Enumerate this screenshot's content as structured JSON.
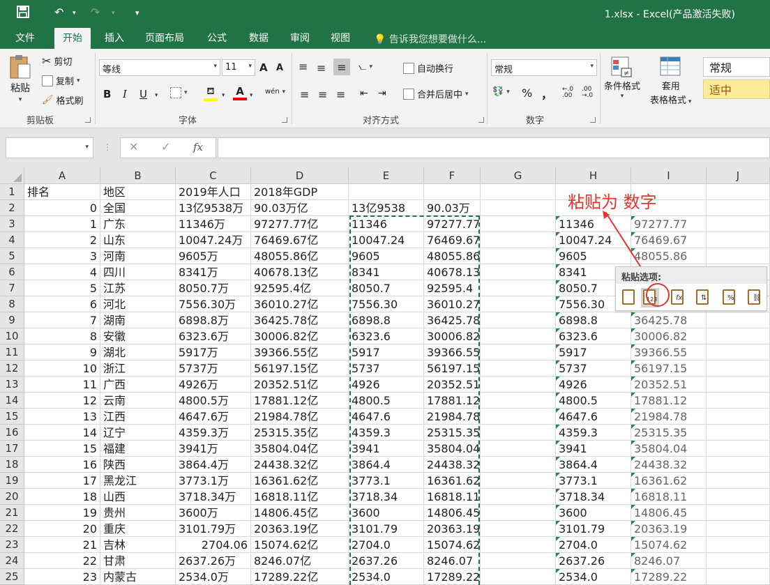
{
  "titlebar": {
    "title": "1.xlsx - Excel(产品激活失败)",
    "qa_dropdown": "▾"
  },
  "tabs": [
    "文件",
    "开始",
    "插入",
    "页面布局",
    "公式",
    "数据",
    "审阅",
    "视图"
  ],
  "tell_me": "告诉我您想要做什么...",
  "ribbon": {
    "clipboard": {
      "paste": "粘贴",
      "cut": "剪切",
      "copy": "复制",
      "format_painter": "格式刷",
      "label": "剪贴板"
    },
    "font": {
      "name": "等线",
      "size": "11",
      "label": "字体",
      "bold": "B",
      "italic": "I",
      "underline": "U",
      "grow": "A",
      "shrink": "A",
      "font_color": "A",
      "phonetic": "wén"
    },
    "alignment": {
      "wrap": "自动换行",
      "merge": "合并后居中",
      "label": "对齐方式"
    },
    "number": {
      "format": "常规",
      "label": "数字",
      "percent": "%",
      "comma": "，",
      "inc": "←.0\n.00",
      "dec": ".00\n→.0"
    },
    "styles": {
      "conditional": "条件格式",
      "table": "套用",
      "table2": "表格格式",
      "normal": "常规",
      "neutral": "适中"
    }
  },
  "formula": {
    "fx": "fx",
    "cancel": "✕",
    "enter": "✓"
  },
  "columns": [
    "A",
    "B",
    "C",
    "D",
    "E",
    "F",
    "G",
    "H",
    "I",
    "J"
  ],
  "rows": [
    {
      "n": "1",
      "A": "排名",
      "B": "地区",
      "C": "2019年人口",
      "D": "2018年GDP",
      "E": "",
      "F": "",
      "H": "",
      "I": ""
    },
    {
      "n": "2",
      "A": "0",
      "B": "全国",
      "C": "13亿9538万",
      "D": "90.03万亿",
      "E": "13亿9538",
      "F": "90.03万",
      "H": "",
      "I": ""
    },
    {
      "n": "3",
      "A": "1",
      "B": "广东",
      "C": "11346万",
      "D": "97277.77亿",
      "E": "11346",
      "F": "97277.77",
      "H": "11346",
      "I": "97277.77"
    },
    {
      "n": "4",
      "A": "2",
      "B": "山东",
      "C": "10047.24万",
      "D": "76469.67亿",
      "E": "10047.24",
      "F": "76469.67",
      "H": "10047.24",
      "I": "76469.67"
    },
    {
      "n": "5",
      "A": "3",
      "B": "河南",
      "C": "9605万",
      "D": "48055.86亿",
      "E": "9605",
      "F": "48055.86",
      "H": "9605",
      "I": "48055.86"
    },
    {
      "n": "6",
      "A": "4",
      "B": "四川",
      "C": "8341万",
      "D": "40678.13亿",
      "E": "8341",
      "F": "40678.13",
      "H": "8341",
      "I": ""
    },
    {
      "n": "7",
      "A": "5",
      "B": "江苏",
      "C": "8050.7万",
      "D": "92595.4亿",
      "E": "8050.7",
      "F": "92595.4",
      "H": "8050.7",
      "I": ""
    },
    {
      "n": "8",
      "A": "6",
      "B": "河北",
      "C": "7556.30万",
      "D": "36010.27亿",
      "E": "7556.30",
      "F": "36010.27",
      "H": "7556.30",
      "I": ""
    },
    {
      "n": "9",
      "A": "7",
      "B": "湖南",
      "C": "6898.8万",
      "D": "36425.78亿",
      "E": "6898.8",
      "F": "36425.78",
      "H": "6898.8",
      "I": "36425.78"
    },
    {
      "n": "10",
      "A": "8",
      "B": "安徽",
      "C": "6323.6万",
      "D": "30006.82亿",
      "E": "6323.6",
      "F": "30006.82",
      "H": "6323.6",
      "I": "30006.82"
    },
    {
      "n": "11",
      "A": "9",
      "B": "湖北",
      "C": "5917万",
      "D": "39366.55亿",
      "E": "5917",
      "F": "39366.55",
      "H": "5917",
      "I": "39366.55"
    },
    {
      "n": "12",
      "A": "10",
      "B": "浙江",
      "C": "5737万",
      "D": "56197.15亿",
      "E": "5737",
      "F": "56197.15",
      "H": "5737",
      "I": "56197.15"
    },
    {
      "n": "13",
      "A": "11",
      "B": "广西",
      "C": "4926万",
      "D": "20352.51亿",
      "E": "4926",
      "F": "20352.51",
      "H": "4926",
      "I": "20352.51"
    },
    {
      "n": "14",
      "A": "12",
      "B": "云南",
      "C": "4800.5万",
      "D": "17881.12亿",
      "E": "4800.5",
      "F": "17881.12",
      "H": "4800.5",
      "I": "17881.12"
    },
    {
      "n": "15",
      "A": "13",
      "B": "江西",
      "C": "4647.6万",
      "D": "21984.78亿",
      "E": "4647.6",
      "F": "21984.78",
      "H": "4647.6",
      "I": "21984.78"
    },
    {
      "n": "16",
      "A": "14",
      "B": "辽宁",
      "C": "4359.3万",
      "D": "25315.35亿",
      "E": "4359.3",
      "F": "25315.35",
      "H": "4359.3",
      "I": "25315.35"
    },
    {
      "n": "17",
      "A": "15",
      "B": "福建",
      "C": "3941万",
      "D": "35804.04亿",
      "E": "3941",
      "F": "35804.04",
      "H": "3941",
      "I": "35804.04"
    },
    {
      "n": "18",
      "A": "16",
      "B": "陕西",
      "C": "3864.4万",
      "D": "24438.32亿",
      "E": "3864.4",
      "F": "24438.32",
      "H": "3864.4",
      "I": "24438.32"
    },
    {
      "n": "19",
      "A": "17",
      "B": "黑龙江",
      "C": "3773.1万",
      "D": "16361.62亿",
      "E": "3773.1",
      "F": "16361.62",
      "H": "3773.1",
      "I": "16361.62"
    },
    {
      "n": "20",
      "A": "18",
      "B": "山西",
      "C": "3718.34万",
      "D": "16818.11亿",
      "E": "3718.34",
      "F": "16818.11",
      "H": "3718.34",
      "I": "16818.11"
    },
    {
      "n": "21",
      "A": "19",
      "B": "贵州",
      "C": "3600万",
      "D": "14806.45亿",
      "E": "3600",
      "F": "14806.45",
      "H": "3600",
      "I": "14806.45"
    },
    {
      "n": "22",
      "A": "20",
      "B": "重庆",
      "C": "3101.79万",
      "D": "20363.19亿",
      "E": "3101.79",
      "F": "20363.19",
      "H": "3101.79",
      "I": "20363.19"
    },
    {
      "n": "23",
      "A": "21",
      "B": "吉林",
      "C": "2704.06",
      "D": "15074.62亿",
      "E": "2704.0",
      "F": "15074.62",
      "H": "2704.0",
      "I": "15074.62"
    },
    {
      "n": "24",
      "A": "22",
      "B": "甘肃",
      "C": "2637.26万",
      "D": "8246.07亿",
      "E": "2637.26",
      "F": "8246.07",
      "H": "2637.26",
      "I": "8246.07"
    },
    {
      "n": "25",
      "A": "23",
      "B": "内蒙古",
      "C": "2534.0万",
      "D": "17289.22亿",
      "E": "2534.0",
      "F": "17289.22",
      "H": "2534.0",
      "I": "17289.22"
    }
  ],
  "paste_options": {
    "title": "粘贴选项:",
    "values_label": "123",
    "formula_label": "fx",
    "percent_label": "%"
  },
  "annotation": "粘贴为 数字",
  "colors": {
    "excel_green": "#217346",
    "annotation_red": "#e8332f",
    "marquee": "#1e7145"
  }
}
